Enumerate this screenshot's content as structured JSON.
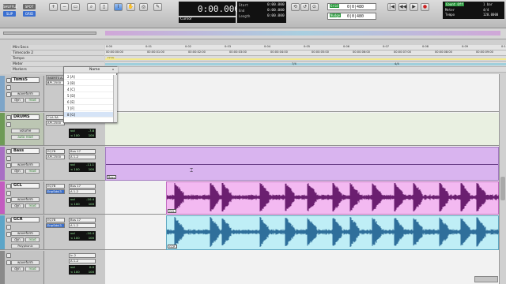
{
  "transport": {
    "modes": [
      "SHUFFLE",
      "SPOT",
      "SLIP",
      "GRID"
    ],
    "main_counter": "0:00.000",
    "cursor_label": "Cursor",
    "start_label": "Start",
    "end_label": "End",
    "length_label": "Length",
    "start_value": "0:00.000",
    "end_value": "0:00.000",
    "length_value": "0:00.000",
    "nudge_value": "0|0|480",
    "grid_value": "0|0|480",
    "count_off": "Count Off",
    "meter_label": "Meter",
    "tempo_label": "Tempo",
    "meter_value": "4/4",
    "tempo_value": "120.0000",
    "bar_value": "1 bar",
    "dly_label": "Dly"
  },
  "rulers": {
    "labels": [
      "Min:Secs",
      "Timecode 2",
      "Tempo",
      "Meter",
      "Markers"
    ],
    "minsecs_ticks": [
      "0:00",
      "0:01",
      "0:02",
      "0:03",
      "0:04",
      "0:05",
      "0:06",
      "0:07",
      "0:08",
      "0:09",
      "0:10"
    ],
    "timecode_ticks": [
      "00:00:00:00",
      "00:00:01:00",
      "00:00:02:00",
      "00:00:03:00",
      "00:00:04:00",
      "00:00:05:00",
      "00:00:06:00",
      "00:00:07:00",
      "00:00:08:00",
      "00:00:09:00"
    ],
    "tempo_value": "J120",
    "meter_marks": [
      "7/4",
      "4/4"
    ]
  },
  "group_list": {
    "header": "Name",
    "items": [
      "[A]",
      "[B]",
      "[C]",
      "[D]",
      "[E]",
      "[F]",
      "[G]"
    ]
  },
  "inserts_header": "INSERTS A-E",
  "tracks": [
    {
      "name": "Toms5",
      "mode": "waveform",
      "dyn": "dyn",
      "read": "read",
      "insert1": "API-2500",
      "insert2": "",
      "io1": "",
      "io2": "",
      "vol": "",
      "color": "#7ea5c8",
      "waveform": false
    },
    {
      "name": "DRUMS",
      "mode": "volume",
      "dyn": "",
      "read": "auto read",
      "insert1": "CLA-3A",
      "insert2": "API-2500",
      "io1": "",
      "io2": "",
      "vol": "-7.8",
      "pan": "100",
      "color": "#6e9b56",
      "waveform": false
    },
    {
      "name": "Bass",
      "mode": "waveform",
      "dyn": "dyn",
      "read": "read",
      "insert1": "EQ7B",
      "insert2": "API-2500",
      "io1": "Bus 17",
      "io2": "A 1-2",
      "vol": "-11.1",
      "pan": "100",
      "color": "#a86fc4",
      "waveform": false,
      "clip_name": "Bass"
    },
    {
      "name": "GCL",
      "mode": "waveform",
      "dyn": "dyn",
      "read": "read",
      "insert1": "EQ7B",
      "insert2": "EnpSdvl3",
      "io1": "Bus 17",
      "io2": "A 1-2",
      "vol": "-10.4",
      "pan": "100",
      "color": "#c35cc0",
      "waveform": true,
      "clip_name": "GCL"
    },
    {
      "name": "GCR",
      "mode": "waveform",
      "dyn": "dyn",
      "read": "read",
      "insert1": "EQ7B",
      "insert2": "EnpSdvl3",
      "io1": "Bus 17",
      "io2": "A 1-2",
      "vol": "-10.4",
      "pan": "100",
      "color": "#5ca5c8",
      "waveform": true,
      "clip_name": "GCR",
      "extra": "Polyphonic"
    },
    {
      "name": "",
      "mode": "waveform",
      "dyn": "dyn",
      "read": "read",
      "insert1": "",
      "insert2": "",
      "io1": "In 2",
      "io2": "A 1-2",
      "vol": "0.0",
      "pan": "100",
      "color": "#8a8a8a",
      "waveform": false
    }
  ],
  "colors": {
    "bass_clip": "#d9b4ef",
    "gcl_clip": "#f3b9f1",
    "gcl_wave": "#6b1f70",
    "gcr_clip": "#bfeef6",
    "gcr_wave": "#2f6f9b",
    "counter_bg": "#111111"
  }
}
